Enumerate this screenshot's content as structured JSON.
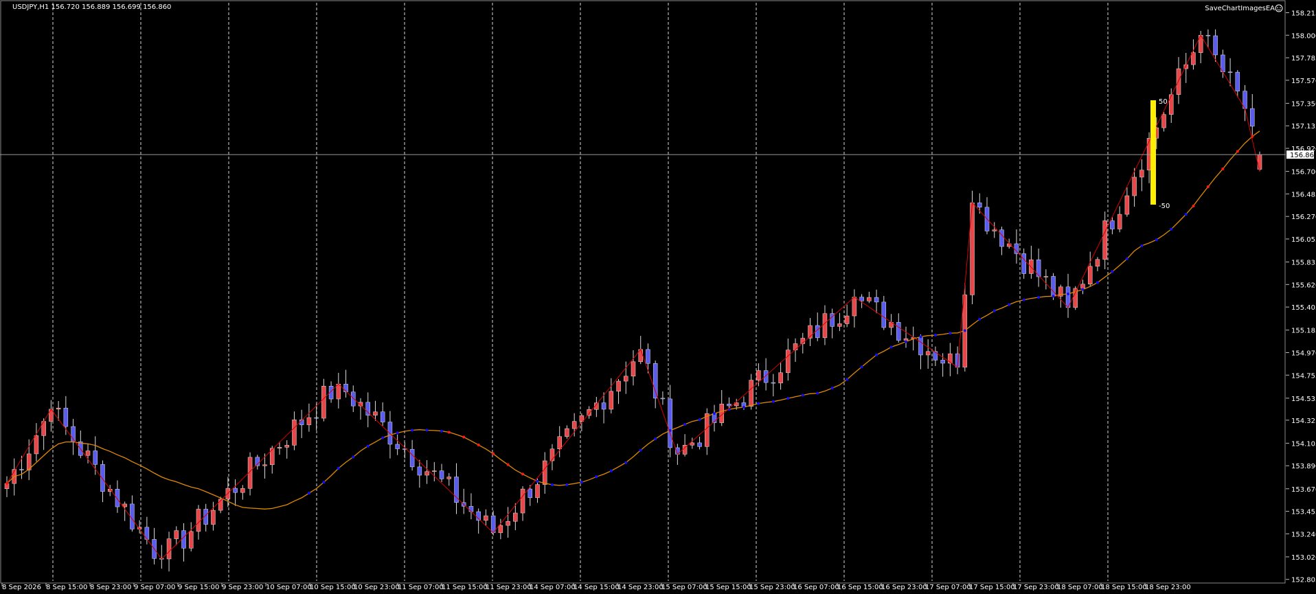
{
  "window": {
    "title": "USDJPY,H1  156.720 156.889 156.699 156.860",
    "ea_label": "SaveChartImagesEA",
    "current_price_label": "156.860"
  },
  "colors": {
    "background": "#000000",
    "bull": "#e8474a",
    "bear": "#5a5cf0",
    "zigzag": "#d40000",
    "ma_line": "#e08a00",
    "ma_up_marker": "#1010ff",
    "ma_down_marker": "#ff1a1a",
    "oscillator_bar": "#ffee00",
    "grid": "#ffffff"
  },
  "chart_data": {
    "type": "candlestick",
    "symbol": "USDJPY",
    "timeframe": "H1",
    "ohlc_readout": {
      "open": 156.72,
      "high": 156.889,
      "low": 156.699,
      "close": 156.86
    },
    "ylim": [
      152.79,
      158.31
    ],
    "y_ticks": [
      "158.215",
      "158.000",
      "157.785",
      "157.570",
      "157.350",
      "157.135",
      "156.920",
      "156.700",
      "156.485",
      "156.270",
      "156.055",
      "155.835",
      "155.620",
      "155.405",
      "155.185",
      "154.970",
      "154.755",
      "154.535",
      "154.325",
      "154.105",
      "153.890",
      "153.670",
      "153.455",
      "153.240",
      "153.020",
      "152.805"
    ],
    "x_ticks": [
      "8 Sep 2026",
      "8 Sep 15:00",
      "8 Sep 23:00",
      "9 Sep 07:00",
      "9 Sep 15:00",
      "9 Sep 23:00",
      "10 Sep 07:00",
      "10 Sep 15:00",
      "10 Sep 23:00",
      "11 Sep 07:00",
      "11 Sep 15:00",
      "11 Sep 23:00",
      "14 Sep 07:00",
      "14 Sep 15:00",
      "14 Sep 23:00",
      "15 Sep 07:00",
      "15 Sep 15:00",
      "15 Sep 23:00",
      "16 Sep 07:00",
      "16 Sep 15:00",
      "16 Sep 23:00",
      "17 Sep 07:00",
      "17 Sep 15:00",
      "17 Sep 23:00",
      "18 Sep 07:00",
      "18 Sep 15:00",
      "18 Sep 23:00"
    ],
    "vertical_grid_after_tick": [
      1,
      3,
      5,
      7,
      9,
      11,
      13,
      15,
      17,
      19,
      21,
      23,
      25
    ],
    "current_price": 156.86,
    "zigzag_points": [
      [
        0,
        153.72
      ],
      [
        6,
        154.43
      ],
      [
        21,
        153.0
      ],
      [
        45,
        154.67
      ],
      [
        66,
        153.25
      ],
      [
        86,
        155.0
      ],
      [
        91,
        154.0
      ],
      [
        115,
        155.5
      ],
      [
        129,
        154.83
      ],
      [
        131,
        156.4
      ],
      [
        144,
        155.4
      ],
      [
        162,
        158.0
      ],
      [
        168,
        157.3
      ],
      [
        170,
        156.7
      ]
    ],
    "ma_trend_segments": [
      {
        "from": 0,
        "to": 1,
        "dir": "down"
      },
      {
        "from": 2,
        "to": 40,
        "dir": "flat"
      },
      {
        "from": 41,
        "to": 59,
        "dir": "up"
      },
      {
        "from": 60,
        "to": 71,
        "dir": "down"
      },
      {
        "from": 72,
        "to": 160,
        "dir": "up"
      },
      {
        "from": 161,
        "to": 170,
        "dir": "down"
      }
    ],
    "oscillator": {
      "upper_label": "50",
      "lower_label": "-50"
    }
  }
}
